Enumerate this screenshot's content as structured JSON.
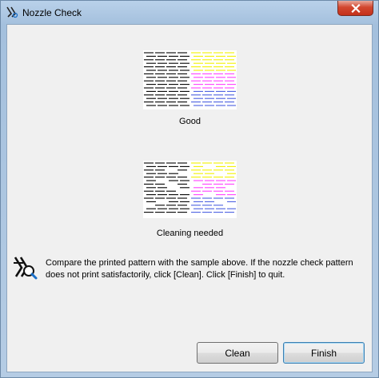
{
  "window": {
    "title": "Nozzle Check",
    "icon": "printer-nozzle-icon",
    "close_icon": "close-icon"
  },
  "samples": {
    "good": {
      "label": "Good"
    },
    "bad": {
      "label": "Cleaning needed"
    }
  },
  "message": {
    "icon": "info-magnifier-icon",
    "text": "Compare the printed pattern with the sample above. If the nozzle check pattern does not print satisfactorily, click [Clean]. Click [Finish] to quit."
  },
  "buttons": {
    "clean_label": "Clean",
    "finish_label": "Finish"
  },
  "colors": {
    "black": "#000000",
    "yellow": "#f2f200",
    "magenta": "#ff40ff",
    "blue": "#4a5fe0",
    "close_red": "#d2472f"
  }
}
